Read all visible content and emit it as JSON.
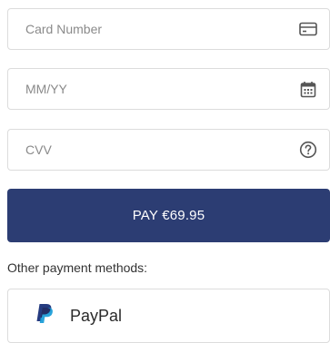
{
  "card_number": {
    "placeholder": "Card Number",
    "icon": "credit-card-icon"
  },
  "expiry": {
    "placeholder": "MM/YY",
    "icon": "calendar-icon"
  },
  "cvv": {
    "placeholder": "CVV",
    "icon": "help-circle-icon"
  },
  "pay_button": {
    "label": "PAY €69.95"
  },
  "other_methods": {
    "label": "Other payment methods:",
    "paypal": {
      "label": "PayPal",
      "icon": "paypal-logo-icon"
    }
  },
  "colors": {
    "pay_button_bg": "#2c3d73",
    "paypal_dark": "#253b80",
    "paypal_light": "#179bd7"
  }
}
